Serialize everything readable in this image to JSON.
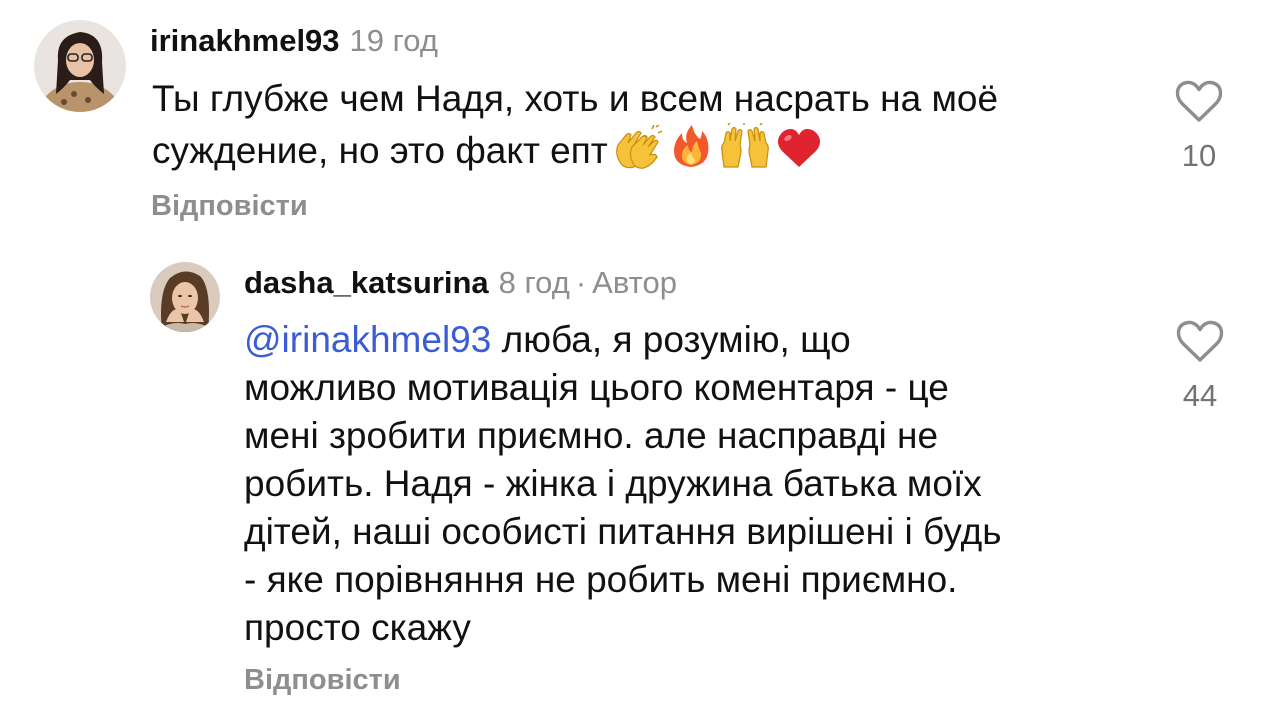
{
  "comments": [
    {
      "username": "irinakhmel93",
      "time": "19 год",
      "text_lines": [
        "Ты глубже чем Надя, хоть и всем насрать на моё",
        "суждение, но это факт епт"
      ],
      "emojis": [
        "clapping-hands-emoji",
        "fire-emoji",
        "raising-hands-emoji",
        "red-heart-emoji"
      ],
      "reply_label": "Відповісти",
      "like_count": "10"
    },
    {
      "username": "dasha_katsurina",
      "time": "8 год",
      "separator": "·",
      "author_badge": "Автор",
      "mention": "@irinakhmel93",
      "text_lines": [
        " люба, я розумію, що",
        "можливо мотивація цього коментаря - це",
        "мені зробити приємно. але насправді не",
        "робить. Надя - жінка і дружина батька моїх",
        "дітей, наші особисті питання вирішені і будь",
        "- яке порівняння не робить мені приємно.",
        "просто скажу"
      ],
      "reply_label": "Відповісти",
      "like_count": "44"
    }
  ],
  "colors": {
    "text": "#111111",
    "muted": "#8e8e8e",
    "mention": "#3b5dd4",
    "like_count": "#737373"
  }
}
